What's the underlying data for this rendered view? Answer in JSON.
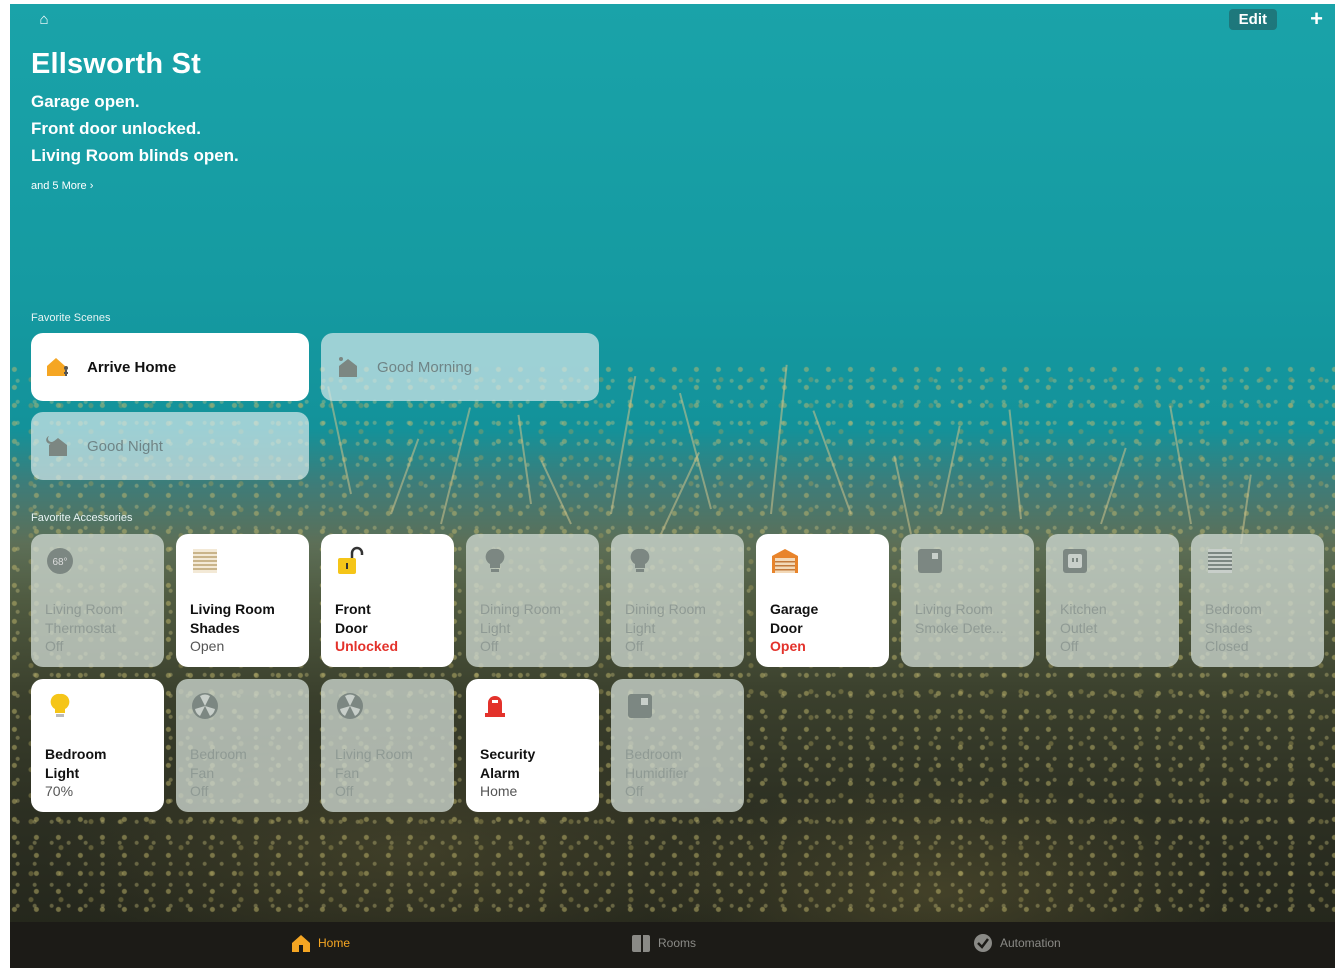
{
  "header": {
    "title": "Ellsworth St",
    "edit_label": "Edit",
    "add_label": "+",
    "status_lines": [
      "Garage open.",
      "Front door unlocked.",
      "Living Room blinds open."
    ],
    "more_label": "and 5 More"
  },
  "scenes": {
    "section_label": "Favorite Scenes",
    "items": [
      {
        "name": "Arrive Home",
        "active": true,
        "icon": "arrive-home-icon"
      },
      {
        "name": "Good Morning",
        "active": false,
        "icon": "good-morning-icon"
      },
      {
        "name": "Good Night",
        "active": false,
        "icon": "good-night-icon"
      }
    ]
  },
  "accessories": {
    "section_label": "Favorite Accessories",
    "items": [
      {
        "name": "Living Room\nThermostat",
        "status": "Off",
        "active": false,
        "icon": "thermostat-icon"
      },
      {
        "name": "Living Room\nShades",
        "status": "Open",
        "active": true,
        "icon": "shades-icon"
      },
      {
        "name": "Front\nDoor",
        "status": "Unlocked",
        "active": true,
        "alert": true,
        "icon": "lock-icon"
      },
      {
        "name": "Dining Room\nLight",
        "status": "Off",
        "active": false,
        "icon": "bulb-icon"
      },
      {
        "name": "Dining Room\nLight",
        "status": "Off",
        "active": false,
        "icon": "bulb-icon"
      },
      {
        "name": "Garage\nDoor",
        "status": "Open",
        "active": true,
        "alert": true,
        "icon": "garage-door-icon"
      },
      {
        "name": "Living Room\nSmoke Dete...",
        "status": "",
        "active": false,
        "icon": "smoke-detector-icon"
      },
      {
        "name": "Kitchen\nOutlet",
        "status": "Off",
        "active": false,
        "icon": "outlet-icon"
      },
      {
        "name": "Bedroom\nShades",
        "status": "Closed",
        "active": false,
        "icon": "shades-icon"
      },
      {
        "name": "Bedroom\nLight",
        "status": "70%",
        "active": true,
        "icon": "bulb-on-icon"
      },
      {
        "name": "Bedroom\nFan",
        "status": "Off",
        "active": false,
        "icon": "fan-icon"
      },
      {
        "name": "Living Room\nFan",
        "status": "Off",
        "active": false,
        "icon": "fan-icon"
      },
      {
        "name": "Security\nAlarm",
        "status": "Home",
        "active": true,
        "icon": "alarm-icon"
      },
      {
        "name": "Bedroom\nHumidifier",
        "status": "Off",
        "active": false,
        "icon": "humidifier-icon"
      }
    ]
  },
  "tabs": [
    {
      "label": "Home",
      "active": true,
      "icon": "home-tab-icon"
    },
    {
      "label": "Rooms",
      "active": false,
      "icon": "rooms-tab-icon"
    },
    {
      "label": "Automation",
      "active": false,
      "icon": "automation-tab-icon"
    }
  ],
  "colors": {
    "accent": "#f5a623",
    "alert": "#e3322b",
    "sky": "#159aa1"
  }
}
